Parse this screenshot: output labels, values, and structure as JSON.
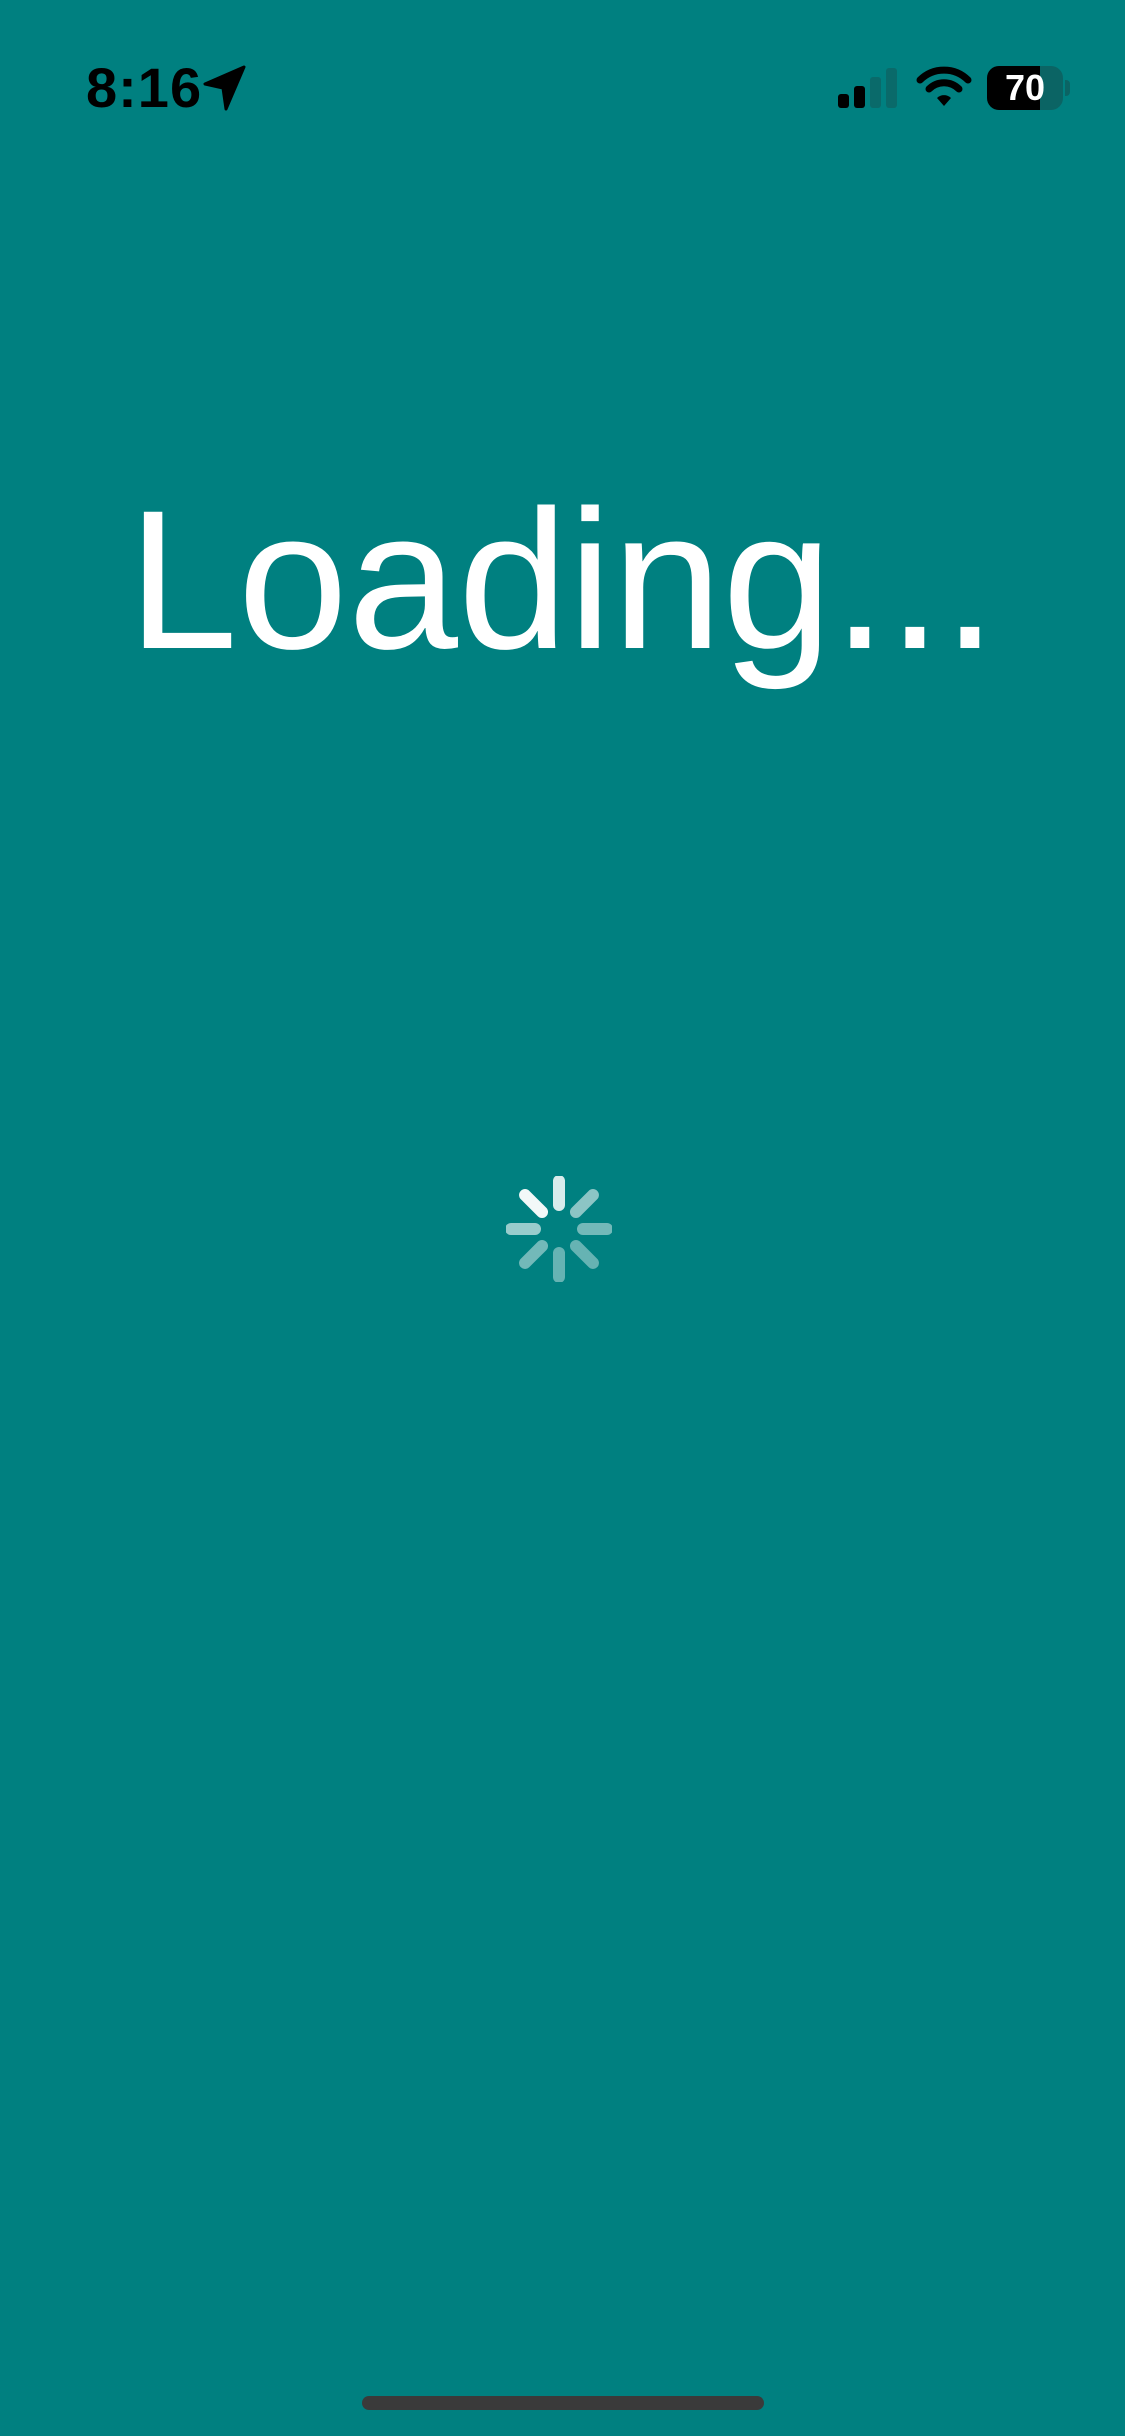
{
  "status_bar": {
    "time": "8:16",
    "location_icon": "location-arrow-icon",
    "signal_icon": "cellular-signal-icon",
    "signal_bars_active": 2,
    "signal_bars_total": 4,
    "wifi_icon": "wifi-icon",
    "battery_level": "70",
    "battery_fraction": 0.7
  },
  "main": {
    "title": "Loading...",
    "spinner_icon": "activity-spinner-icon"
  },
  "colors": {
    "background": "#008080",
    "text": "#ffffff"
  }
}
